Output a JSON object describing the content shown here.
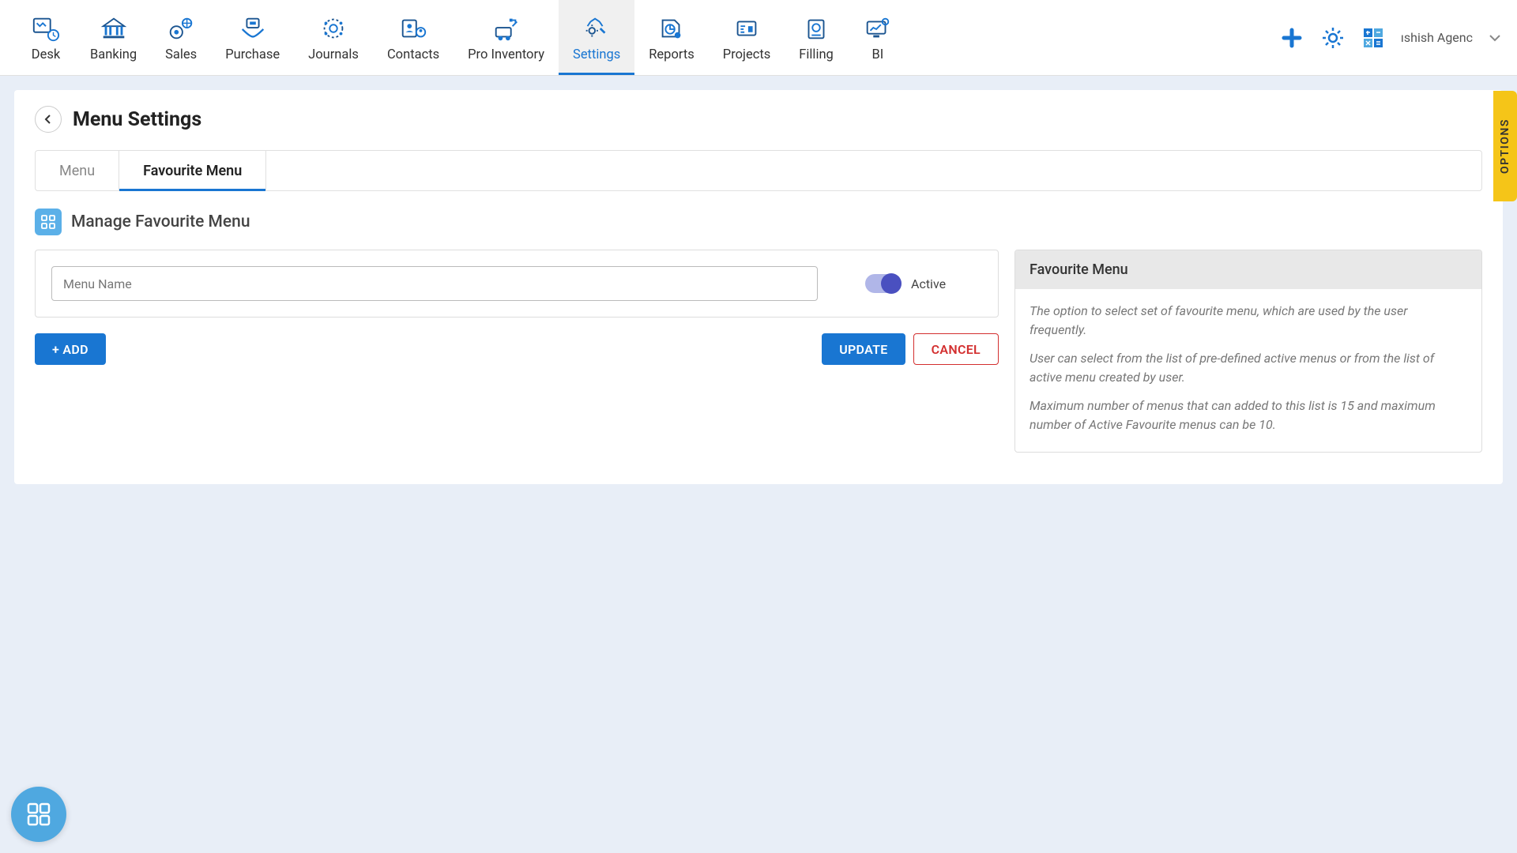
{
  "nav": {
    "items": [
      {
        "label": "Desk"
      },
      {
        "label": "Banking"
      },
      {
        "label": "Sales"
      },
      {
        "label": "Purchase"
      },
      {
        "label": "Journals"
      },
      {
        "label": "Contacts"
      },
      {
        "label": "Pro Inventory"
      },
      {
        "label": "Settings"
      },
      {
        "label": "Reports"
      },
      {
        "label": "Projects"
      },
      {
        "label": "Filling"
      },
      {
        "label": "BI"
      }
    ],
    "active_index": 7,
    "user_label": "ıshish Agenc"
  },
  "page": {
    "title": "Menu Settings",
    "tabs": [
      {
        "label": "Menu"
      },
      {
        "label": "Favourite Menu"
      }
    ],
    "active_tab": 1,
    "section_title": "Manage Favourite Menu"
  },
  "form": {
    "menu_name_placeholder": "Menu Name",
    "toggle_label": "Active",
    "add_btn": "+ ADD",
    "update_btn": "UPDATE",
    "cancel_btn": "CANCEL"
  },
  "info": {
    "title": "Favourite Menu",
    "p1": "The option to select set of favourite menu, which are used by the user frequently.",
    "p2": "User can select from the list of pre-defined active menus or from the list of active menu created by user.",
    "p3": "Maximum number of menus that can added to this list is 15 and maximum number of Active Favourite menus can be 10."
  },
  "options_tab": "OPTIONS"
}
